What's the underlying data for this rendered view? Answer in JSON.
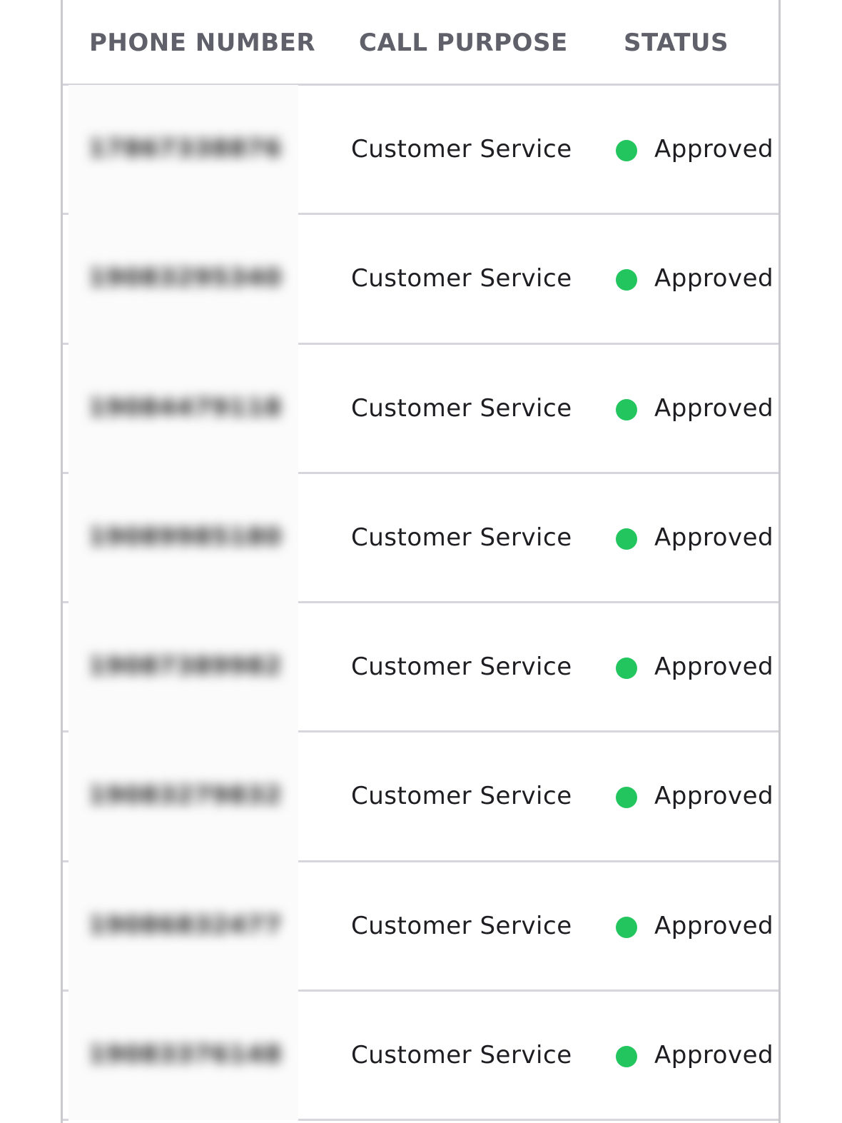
{
  "colors": {
    "status_approved": "#22c55e",
    "header_text": "#5f6069",
    "cell_text": "#1d1d22",
    "divider": "#d6d6dc"
  },
  "table": {
    "headers": {
      "phone": "PHONE NUMBER",
      "purpose": "CALL PURPOSE",
      "status": "STATUS"
    },
    "rows": [
      {
        "phone": "17867338876",
        "purpose": "Customer Service",
        "status": "Approved",
        "status_icon": "green-dot-icon"
      },
      {
        "phone": "19083295340",
        "purpose": "Customer Service",
        "status": "Approved",
        "status_icon": "green-dot-icon"
      },
      {
        "phone": "19084479118",
        "purpose": "Customer Service",
        "status": "Approved",
        "status_icon": "green-dot-icon"
      },
      {
        "phone": "19089985180",
        "purpose": "Customer Service",
        "status": "Approved",
        "status_icon": "green-dot-icon"
      },
      {
        "phone": "19087389982",
        "purpose": "Customer Service",
        "status": "Approved",
        "status_icon": "green-dot-icon"
      },
      {
        "phone": "19083279832",
        "purpose": "Customer Service",
        "status": "Approved",
        "status_icon": "green-dot-icon"
      },
      {
        "phone": "19086832477",
        "purpose": "Customer Service",
        "status": "Approved",
        "status_icon": "green-dot-icon"
      },
      {
        "phone": "19083376148",
        "purpose": "Customer Service",
        "status": "Approved",
        "status_icon": "green-dot-icon"
      }
    ]
  }
}
